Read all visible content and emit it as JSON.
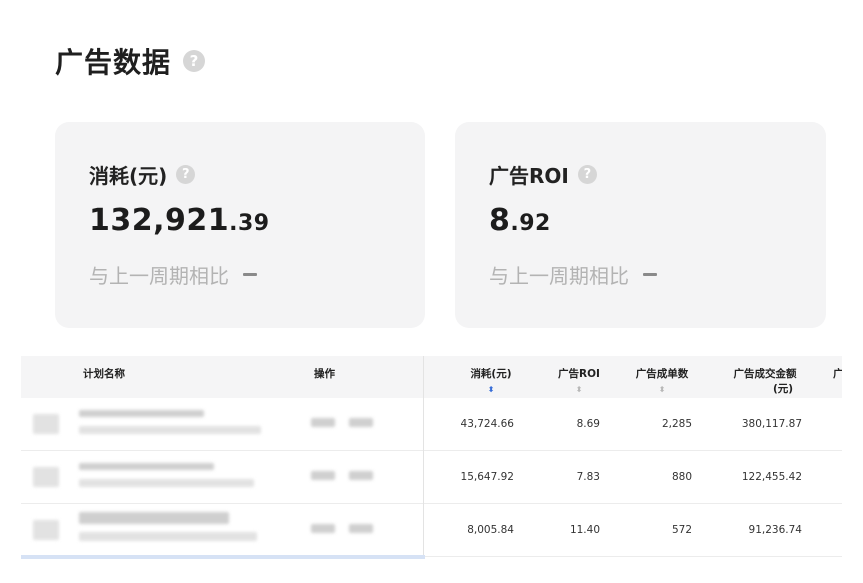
{
  "page": {
    "title": "广告数据",
    "help_icon": "question-circle-icon"
  },
  "cards": [
    {
      "label": "消耗(元)",
      "value_int": "132,921",
      "value_dec": ".39",
      "compare": "与上一周期相比"
    },
    {
      "label": "广告ROI",
      "value_int": "8",
      "value_dec": ".92",
      "compare": "与上一周期相比"
    }
  ],
  "table": {
    "headers": {
      "plan_name": "计划名称",
      "action": "操作",
      "spend": "消耗(元)",
      "roi": "广告ROI",
      "orders": "广告成单数",
      "gmv_line1": "广告成交金额",
      "gmv_line2": "(元)",
      "more": "广"
    },
    "rows": [
      {
        "spend": "43,724.66",
        "roi": "8.69",
        "orders": "2,285",
        "gmv": "380,117.87"
      },
      {
        "spend": "15,647.92",
        "roi": "7.83",
        "orders": "880",
        "gmv": "122,455.42"
      },
      {
        "spend": "8,005.84",
        "roi": "11.40",
        "orders": "572",
        "gmv": "91,236.74"
      }
    ]
  }
}
